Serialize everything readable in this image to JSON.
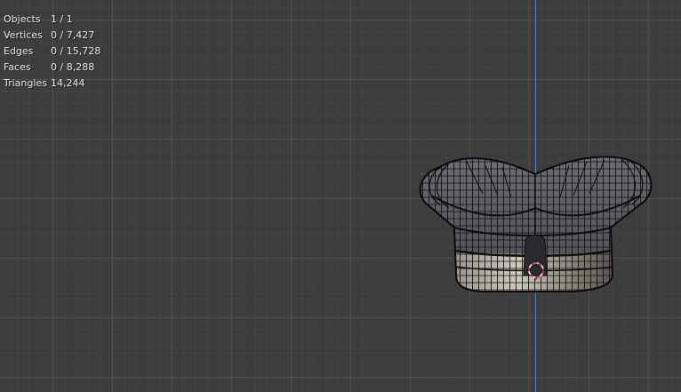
{
  "stats": {
    "rows": [
      {
        "label": "Objects",
        "value": "1 / 1"
      },
      {
        "label": "Vertices",
        "value": "0 / 7,427"
      },
      {
        "label": "Edges",
        "value": "0 / 15,728"
      },
      {
        "label": "Faces",
        "value": "0 / 8,288"
      },
      {
        "label": "Triangles",
        "value": "14,244"
      }
    ]
  },
  "colors": {
    "background": "#3d3d3d",
    "grid": "#555555",
    "axis_z": "#5a7fc2",
    "mesh_fill": "#7d7d82",
    "wire": "#111111",
    "cursor_red": "#d23232"
  },
  "icons": {
    "cursor": "3d-cursor-icon"
  }
}
